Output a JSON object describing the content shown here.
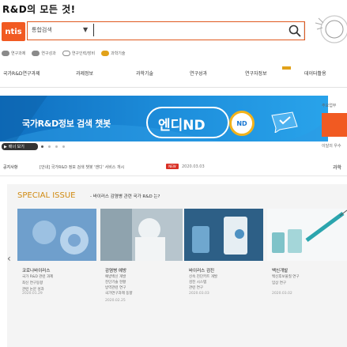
{
  "header": {
    "tagline": "R&D의 모든 것!",
    "logo_label": "ntis"
  },
  "search": {
    "scope": "통합검색",
    "scope_arrow": "▼",
    "placeholder": ""
  },
  "filters": [
    {
      "label": "연구과제",
      "state": "filled"
    },
    {
      "label": "연구성과",
      "state": "filled"
    },
    {
      "label": "연구인력/장비",
      "state": "outline"
    },
    {
      "label": "과학기술",
      "state": "active"
    }
  ],
  "nav": {
    "items": [
      "국가R&D연구과제",
      "과제정보",
      "과학기술",
      "연구성과",
      "연구자정보",
      "데이터활용"
    ]
  },
  "banner": {
    "headline": "국가R&D정보 검색 챗봇",
    "brand": "엔디ND",
    "badge": "ND",
    "control_label": "배너 보기",
    "dots": 4,
    "active_dot": 1
  },
  "side": {
    "label_top": "주요업무",
    "label_bottom": "이달의 우수",
    "label_right": "과학"
  },
  "notice": {
    "head": "공지사항",
    "text": "[안내] 국가R&D 정보 검색 챗봇 '엔디' 서비스 개시",
    "badge": "NEW",
    "date": "2020.03.03"
  },
  "special": {
    "title": "SPECIAL ISSUE",
    "subtitle": "- 바이러스 감염병 관련 국가 R&D 는?",
    "cards": [
      {
        "title": "코로나바이러스",
        "lines": [
          "국가 R&D 관련 과제",
          "최신 연구동향",
          "관련 논문 성과"
        ],
        "date": "2020.01.29"
      },
      {
        "title": "감염병 예방",
        "lines": [
          "예방백신 개발",
          "진단기술 현황",
          "방역관련 연구",
          "국가연구과제 동향"
        ],
        "date": "2020.02.25"
      },
      {
        "title": "바이러스 검진",
        "lines": [
          "신속 진단키트 개발",
          "검진 시스템",
          "관련 연구"
        ],
        "date": "2020.03.03"
      },
      {
        "title": "백신개발",
        "lines": [
          "백신후보물질 연구",
          "임상 연구"
        ],
        "date": "2020.03.02"
      }
    ]
  },
  "colors": {
    "accent": "#f15a22",
    "gold": "#e1a21a",
    "banner_blue": "#1e8fdc",
    "panel_bg": "#f4f4f4"
  }
}
